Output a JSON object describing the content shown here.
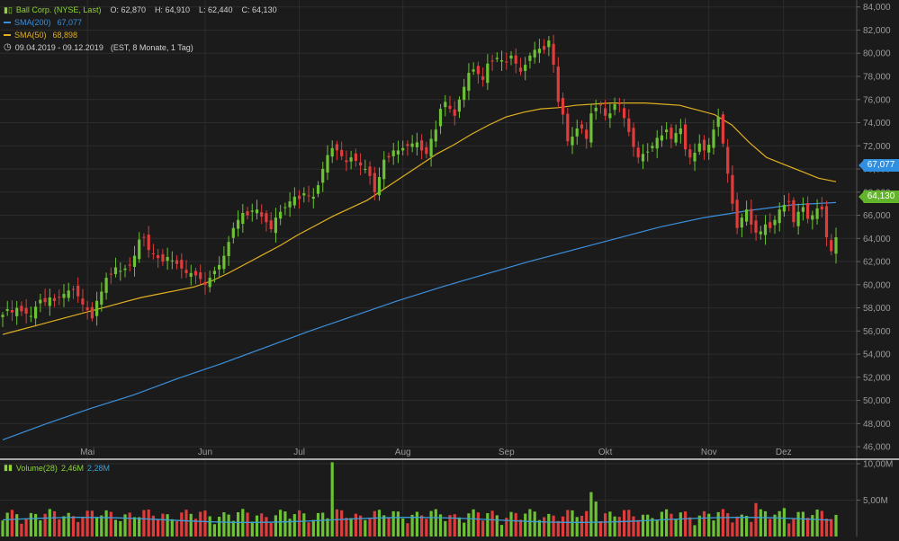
{
  "legend": {
    "title": "Ball Corp. (NYSE, Last)",
    "open": "O: 62,870",
    "high": "H: 64,910",
    "low": "L: 62,440",
    "close": "C: 64,130",
    "sma200_label": "SMA(200)",
    "sma200_value": "67,077",
    "sma50_label": "SMA(50)",
    "sma50_value": "68,898",
    "range": "09.04.2019 - 09.12.2019",
    "range_info": "(EST, 8 Monate, 1 Tag)",
    "volume_label": "Volume(28)",
    "volume_value": "2,46M",
    "volume_avg": "2,28M"
  },
  "tags": {
    "sma200": "67,077",
    "close": "64,130"
  },
  "colors": {
    "background": "#1b1b1b",
    "up": "#6cc234",
    "down": "#e03c3c",
    "sma200": "#3b8fdc",
    "sma50": "#e0b020",
    "grid": "#2c2c2c",
    "axis_text": "#9a9a9a",
    "volume_avg": "#3aa0d8"
  },
  "chart_data": {
    "type": "candlestick",
    "title": "Ball Corp. (NYSE, Last)",
    "x_labels": [
      "Mai",
      "Jun",
      "Jul",
      "Aug",
      "Sep",
      "Okt",
      "Nov",
      "Dez"
    ],
    "y_ticks": [
      "46,000",
      "48,000",
      "50,000",
      "52,000",
      "54,000",
      "56,000",
      "58,000",
      "60,000",
      "62,000",
      "64,000",
      "66,000",
      "68,000",
      "70,000",
      "72,000",
      "74,000",
      "76,000",
      "78,000",
      "80,000",
      "82,000",
      "84,000"
    ],
    "ylim": [
      45,
      84.6
    ],
    "volume_ticks": [
      "5,00M",
      "10,00M"
    ],
    "volume_ylim": [
      0,
      10.5
    ],
    "candle_count": 168,
    "close_series": [
      57.4,
      57.9,
      57.6,
      58.0,
      57.7,
      57.5,
      57.3,
      58.1,
      58.7,
      58.5,
      58.9,
      58.6,
      58.9,
      59.2,
      59.5,
      59.6,
      59.0,
      58.3,
      57.8,
      57.1,
      58.6,
      59.4,
      60.6,
      60.9,
      61.5,
      61.2,
      61.4,
      61.7,
      62.5,
      63.9,
      64.1,
      63.0,
      62.7,
      62.3,
      62.0,
      62.4,
      62.1,
      61.8,
      61.4,
      61.0,
      61.0,
      60.8,
      60.5,
      60.0,
      60.6,
      61.2,
      61.7,
      62.5,
      63.7,
      64.9,
      65.6,
      66.2,
      66.0,
      66.4,
      66.5,
      65.9,
      65.4,
      64.8,
      65.8,
      66.3,
      66.7,
      67.2,
      67.6,
      67.4,
      67.9,
      67.7,
      67.6,
      68.6,
      70.0,
      71.2,
      71.8,
      71.6,
      71.1,
      70.6,
      71.0,
      70.7,
      70.3,
      70.0,
      69.4,
      68.0,
      69.3,
      70.8,
      71.0,
      71.6,
      71.6,
      71.8,
      72.0,
      72.2,
      72.3,
      71.6,
      71.3,
      72.6,
      73.4,
      75.2,
      75.8,
      75.2,
      74.6,
      76.0,
      77.1,
      78.3,
      78.6,
      78.2,
      77.7,
      79.1,
      79.3,
      79.6,
      79.4,
      79.2,
      79.8,
      79.1,
      78.4,
      79.0,
      79.8,
      80.3,
      80.4,
      80.3,
      81.1,
      79.0,
      75.8,
      74.7,
      72.4,
      72.8,
      73.5,
      73.5,
      72.6,
      74.8,
      75.3,
      75.5,
      74.6,
      74.8,
      75.6,
      75.6,
      74.4,
      73.2,
      71.9,
      71.0,
      71.3,
      71.5,
      72.0,
      72.7,
      72.9,
      73.4,
      72.6,
      73.1,
      73.5,
      71.7,
      71.0,
      71.4,
      72.2,
      71.6,
      72.1,
      73.4,
      74.5,
      72.2,
      69.6,
      67.0,
      64.9,
      65.8,
      66.5,
      65.2,
      64.5,
      64.6,
      65.2,
      64.9,
      65.6,
      66.5,
      66.9,
      67.2,
      65.4,
      66.3,
      66.7,
      65.7,
      66.0,
      66.6,
      66.5,
      64.1,
      62.9,
      64.1
    ],
    "sma50_series": [
      55.7,
      56.1,
      56.5,
      56.9,
      57.3,
      57.7,
      58.1,
      58.5,
      58.9,
      59.2,
      59.5,
      59.8,
      60.3,
      61.0,
      61.8,
      62.6,
      63.4,
      64.3,
      65.1,
      65.9,
      66.6,
      67.3,
      68.3,
      69.3,
      70.3,
      71.3,
      72.1,
      73.0,
      73.8,
      74.5,
      74.9,
      75.2,
      75.3,
      75.5,
      75.6,
      75.7,
      75.7,
      75.7,
      75.6,
      75.5,
      75.1,
      74.7,
      73.8,
      72.3,
      71.0,
      70.4,
      69.8,
      69.2,
      68.9
    ],
    "sma200_series": [
      46.6,
      48.0,
      49.3,
      50.5,
      51.9,
      53.2,
      54.6,
      56.0,
      57.3,
      58.6,
      59.8,
      60.9,
      62.0,
      63.0,
      64.0,
      65.0,
      65.8,
      66.4,
      66.9,
      67.1
    ],
    "volume_avg": 2.28,
    "series": [
      {
        "name": "SMA(200)",
        "last": 67.077
      },
      {
        "name": "SMA(50)",
        "last": 68.898
      },
      {
        "name": "Volume(28)",
        "last": 2.46
      }
    ]
  }
}
